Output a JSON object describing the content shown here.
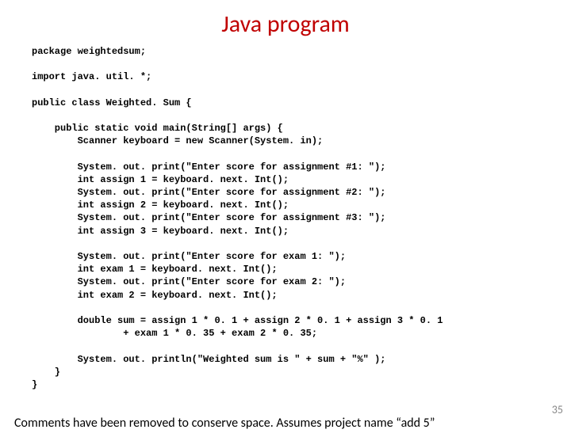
{
  "title": "Java program",
  "code": "package weightedsum;\n\nimport java. util. *;\n\npublic class Weighted. Sum {\n\n    public static void main(String[] args) {\n        Scanner keyboard = new Scanner(System. in);\n\n        System. out. print(\"Enter score for assignment #1: \");\n        int assign 1 = keyboard. next. Int();\n        System. out. print(\"Enter score for assignment #2: \");\n        int assign 2 = keyboard. next. Int();\n        System. out. print(\"Enter score for assignment #3: \");\n        int assign 3 = keyboard. next. Int();\n\n        System. out. print(\"Enter score for exam 1: \");\n        int exam 1 = keyboard. next. Int();\n        System. out. print(\"Enter score for exam 2: \");\n        int exam 2 = keyboard. next. Int();\n\n        double sum = assign 1 * 0. 1 + assign 2 * 0. 1 + assign 3 * 0. 1\n                + exam 1 * 0. 35 + exam 2 * 0. 35;\n\n        System. out. println(\"Weighted sum is \" + sum + \"%\" );\n    }\n}",
  "footer": "Comments have been removed to conserve space. Assumes project name “add 5”",
  "slide_number": "35"
}
